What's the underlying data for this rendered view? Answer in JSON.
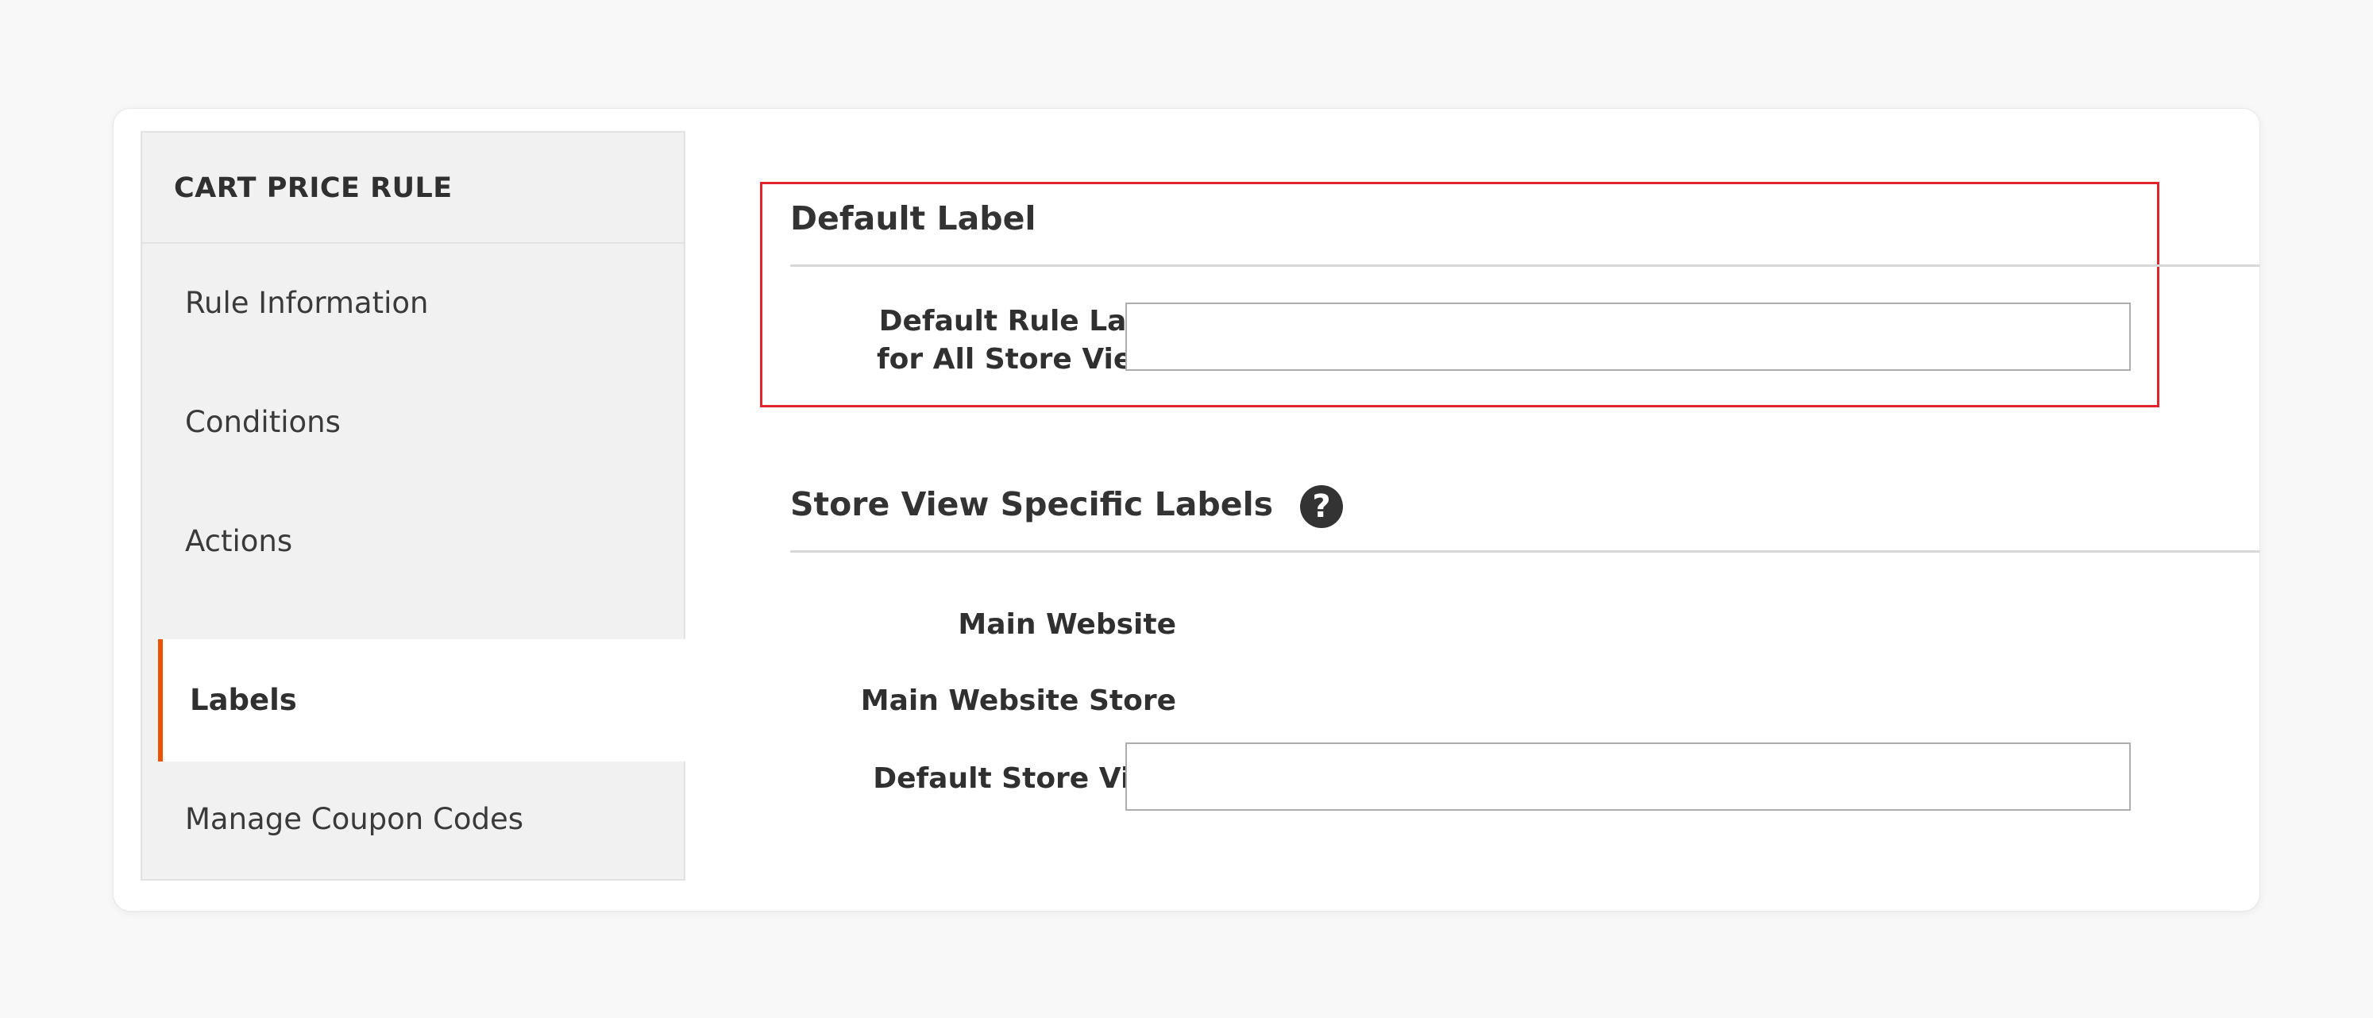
{
  "sidebar": {
    "title": "CART PRICE RULE",
    "items": [
      {
        "label": "Rule Information"
      },
      {
        "label": "Conditions"
      },
      {
        "label": "Actions"
      },
      {
        "label": "Labels"
      },
      {
        "label": "Manage Coupon Codes"
      }
    ],
    "active_item": "Labels",
    "accent_color": "#eb5202"
  },
  "default_label": {
    "title": "Default Label",
    "field_label_line1": "Default Rule Label",
    "field_label_line2": "for All Store Views",
    "value": "",
    "highlight_color": "#e0252f"
  },
  "store_view_labels": {
    "title": "Store View Specific Labels",
    "help_icon": "question-circle-icon",
    "help_glyph": "?",
    "website": "Main Website",
    "store": "Main Website Store",
    "store_view": "Default Store View",
    "store_view_value": ""
  }
}
